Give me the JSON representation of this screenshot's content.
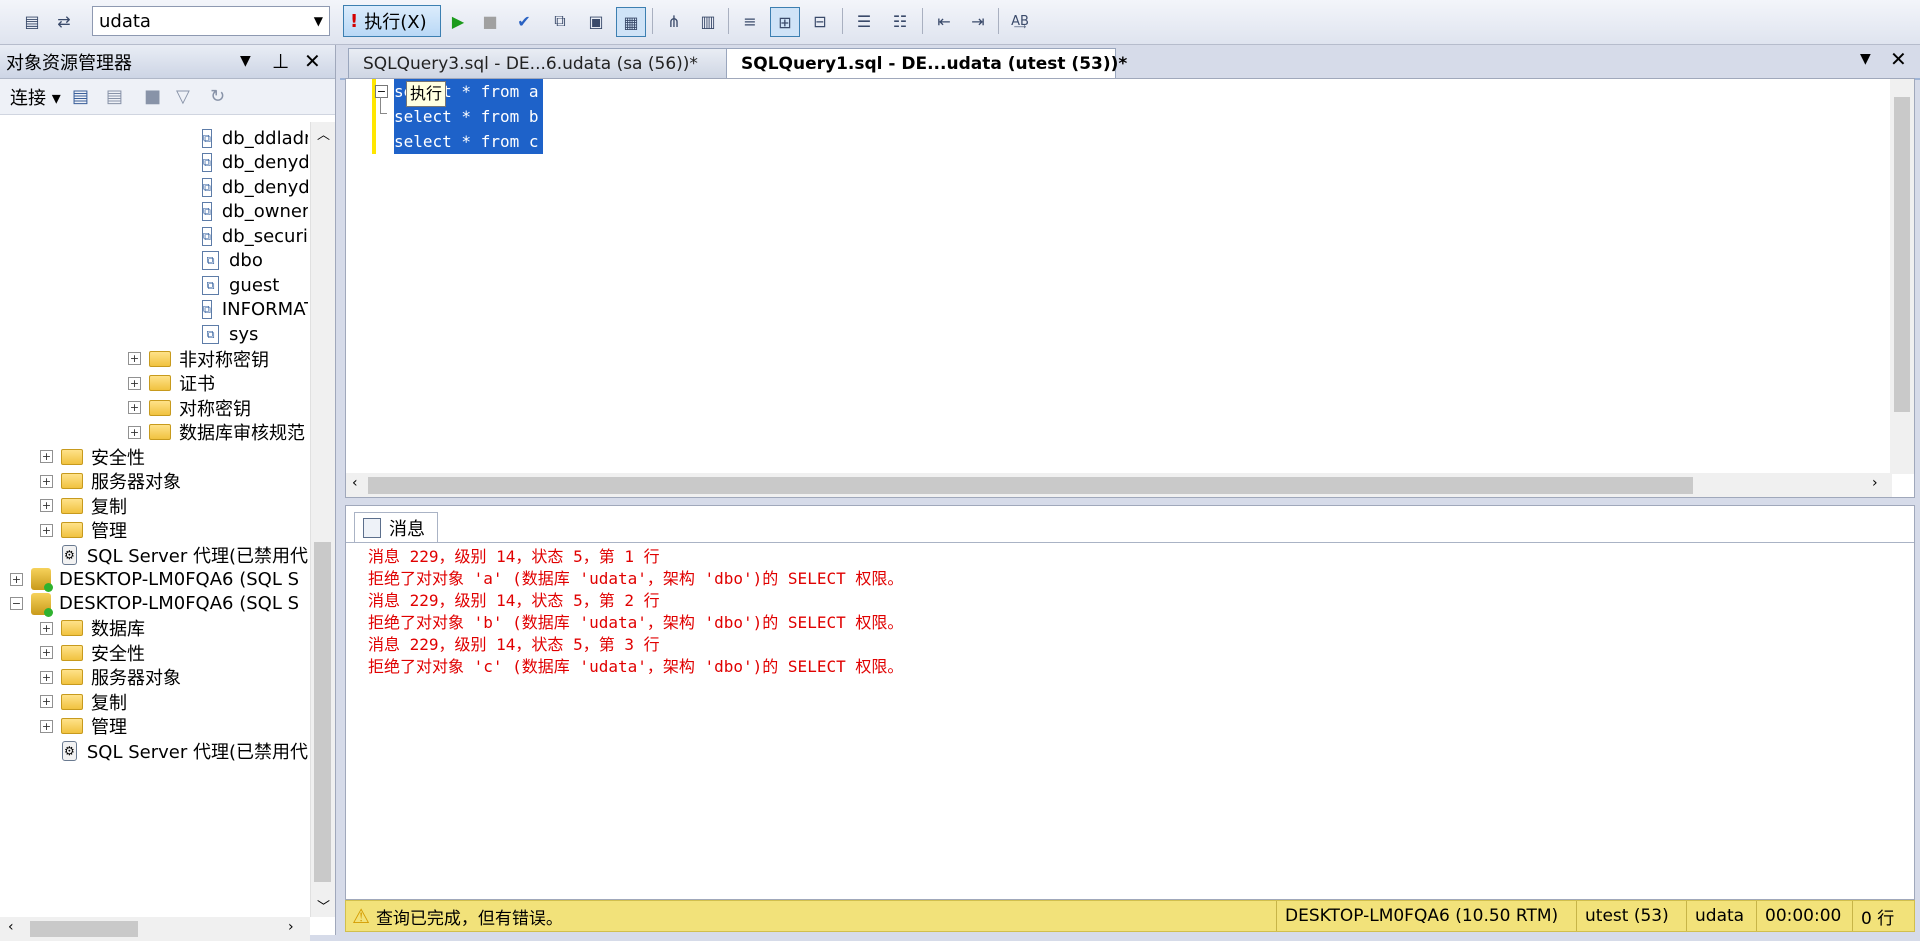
{
  "toolbar": {
    "database": "udata",
    "execute_label": "执行(X)"
  },
  "object_explorer": {
    "title": "对象资源管理器",
    "connect_label": "连接",
    "tree": [
      {
        "label": "db_ddladm",
        "type": "role",
        "level": 3
      },
      {
        "label": "db_denyda",
        "type": "role",
        "level": 3
      },
      {
        "label": "db_denyda",
        "type": "role",
        "level": 3
      },
      {
        "label": "db_owner",
        "type": "role",
        "level": 3
      },
      {
        "label": "db_security",
        "type": "role",
        "level": 3
      },
      {
        "label": "dbo",
        "type": "role",
        "level": 3
      },
      {
        "label": "guest",
        "type": "role",
        "level": 3
      },
      {
        "label": "INFORMAT",
        "type": "role",
        "level": 3
      },
      {
        "label": "sys",
        "type": "role",
        "level": 3
      },
      {
        "label": "非对称密钥",
        "type": "folder",
        "level": 2
      },
      {
        "label": "证书",
        "type": "folder",
        "level": 2
      },
      {
        "label": "对称密钥",
        "type": "folder",
        "level": 2
      },
      {
        "label": "数据库审核规范",
        "type": "folder",
        "level": 2
      },
      {
        "label": "安全性",
        "type": "folder",
        "level": 1
      },
      {
        "label": "服务器对象",
        "type": "folder",
        "level": 1
      },
      {
        "label": "复制",
        "type": "folder",
        "level": 1
      },
      {
        "label": "管理",
        "type": "folder",
        "level": 1
      },
      {
        "label": "SQL Server 代理(已禁用代",
        "type": "agent",
        "level": 1
      },
      {
        "label": "DESKTOP-LM0FQA6 (SQL S",
        "type": "server",
        "level": 0,
        "expanded": false
      },
      {
        "label": "DESKTOP-LM0FQA6 (SQL S",
        "type": "server",
        "level": 0,
        "expanded": true
      },
      {
        "label": "数据库",
        "type": "folder",
        "level": 1
      },
      {
        "label": "安全性",
        "type": "folder",
        "level": 1
      },
      {
        "label": "服务器对象",
        "type": "folder",
        "level": 1
      },
      {
        "label": "复制",
        "type": "folder",
        "level": 1
      },
      {
        "label": "管理",
        "type": "folder",
        "level": 1
      },
      {
        "label": "SQL Server 代理(已禁用代",
        "type": "agent",
        "level": 1
      }
    ]
  },
  "tabs": [
    {
      "label": "SQLQuery3.sql - DE...6.udata (sa (56))*",
      "active": false
    },
    {
      "label": "SQLQuery1.sql - DE...udata (utest (53))*",
      "active": true
    }
  ],
  "editor": {
    "lines": [
      "select * from a",
      "select * from b",
      "select * from c"
    ],
    "tooltip": "执行"
  },
  "results": {
    "tab_label": "消息",
    "lines": [
      "消息 229，级别 14，状态 5，第 1 行",
      "拒绝了对对象 'a' (数据库 'udata'，架构 'dbo')的 SELECT 权限。",
      "消息 229，级别 14，状态 5，第 2 行",
      "拒绝了对对象 'b' (数据库 'udata'，架构 'dbo')的 SELECT 权限。",
      "消息 229，级别 14，状态 5，第 3 行",
      "拒绝了对对象 'c' (数据库 'udata'，架构 'dbo')的 SELECT 权限。"
    ]
  },
  "status": {
    "message": "查询已完成，但有错误。",
    "server": "DESKTOP-LM0FQA6 (10.50 RTM)",
    "user": "utest (53)",
    "database": "udata",
    "time": "00:00:00",
    "rows": "0 行"
  }
}
